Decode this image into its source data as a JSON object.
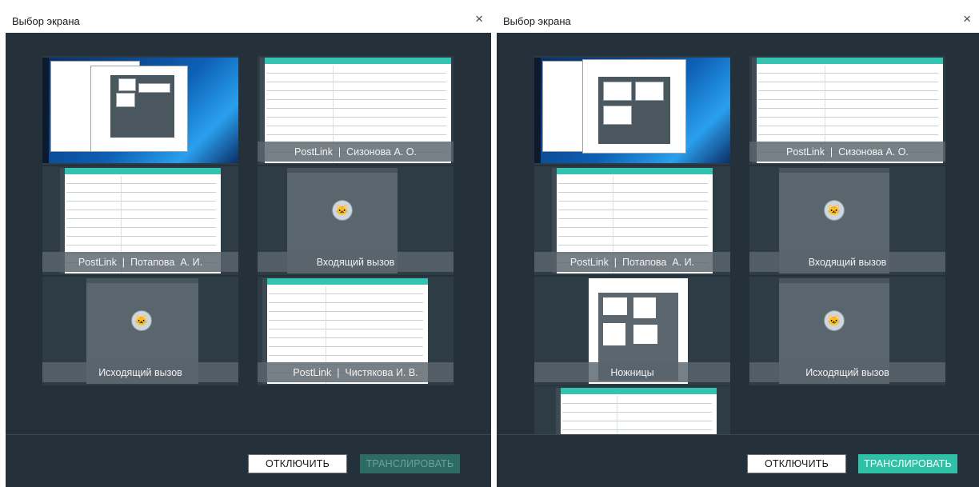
{
  "dialog_title": "Выбор экрана",
  "close_glyph": "×",
  "buttons": {
    "disconnect": "ОТКЛЮЧИТЬ",
    "stream": "ТРАНСЛИРОВАТЬ"
  },
  "left": {
    "stream_enabled": false,
    "windows": [
      {
        "type": "desktop",
        "label": ""
      },
      {
        "type": "app",
        "label": "PostLink  |  Сизонова А. О."
      },
      {
        "type": "app",
        "label": "PostLink  |  Потапова  А. И."
      },
      {
        "type": "call",
        "label": "Входящий вызов"
      },
      {
        "type": "call",
        "label": "Исходящий вызов"
      },
      {
        "type": "app",
        "label": "PostLink  |  Чистякова И. В."
      }
    ]
  },
  "right": {
    "stream_enabled": true,
    "windows": [
      {
        "type": "desktop",
        "label": ""
      },
      {
        "type": "app",
        "label": "PostLink  |  Сизонова А. О."
      },
      {
        "type": "app",
        "label": "PostLink  |  Потапова  А. И."
      },
      {
        "type": "call",
        "label": "Входящий вызов"
      },
      {
        "type": "scissors",
        "label": "Ножницы"
      },
      {
        "type": "call",
        "label": "Исходящий вызов"
      },
      {
        "type": "app",
        "label": ""
      }
    ]
  },
  "colors": {
    "accent": "#2fc0a8",
    "dialog_bg": "#25313a",
    "disabled_button": "#2d6b63"
  }
}
